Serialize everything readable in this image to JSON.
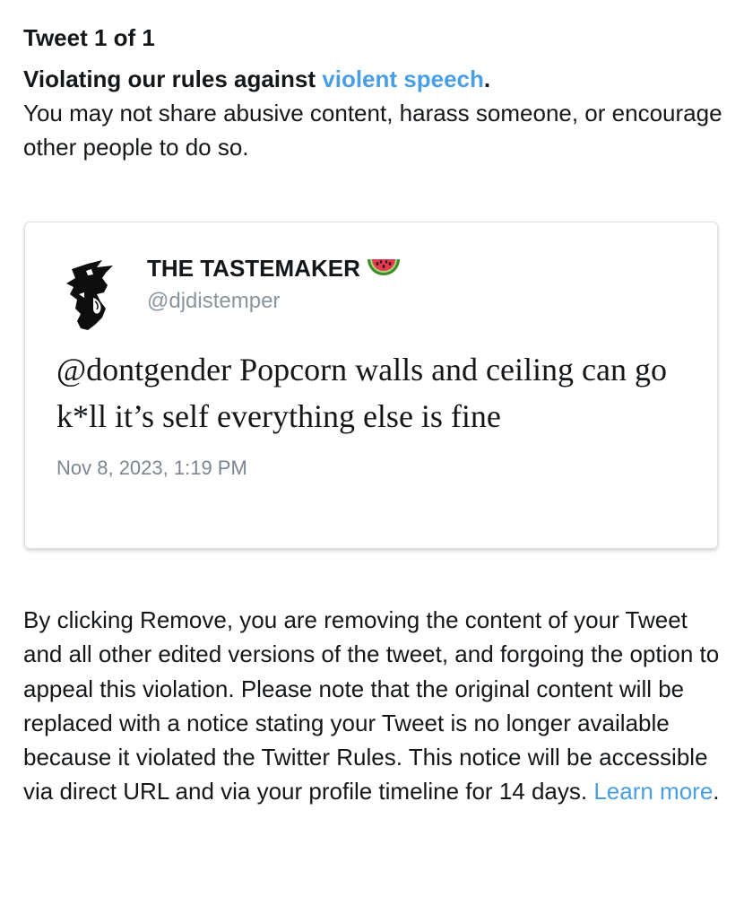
{
  "header": {
    "counter": "Tweet 1 of 1"
  },
  "violation": {
    "prefix": "Violating our rules against ",
    "rule_link": "violent speech",
    "suffix": ".",
    "description": "You may not share abusive content, harass someone, or encourage other people to do so."
  },
  "tweet": {
    "display_name": "THE TASTEMAKER",
    "emoji": "watermelon-emoji",
    "handle": "@djdistemper",
    "text": "@dontgender Popcorn walls and ceiling can go k*ll it’s self everything else is fine",
    "timestamp": "Nov 8, 2023, 1:19 PM"
  },
  "notice": {
    "body": "By clicking Remove, you are removing the content of your Tweet and all other edited versions of the tweet, and forgoing the option to appeal this violation. Please note that the original content will be replaced with a notice stating your Tweet is no longer available because it violated the Twitter Rules. This notice will be accessible via direct URL and via your profile timeline for 14 days. ",
    "learn_more": "Learn more",
    "end": "."
  },
  "colors": {
    "link": "#4a9ee3",
    "text": "#14171a",
    "muted": "#8a949e"
  }
}
